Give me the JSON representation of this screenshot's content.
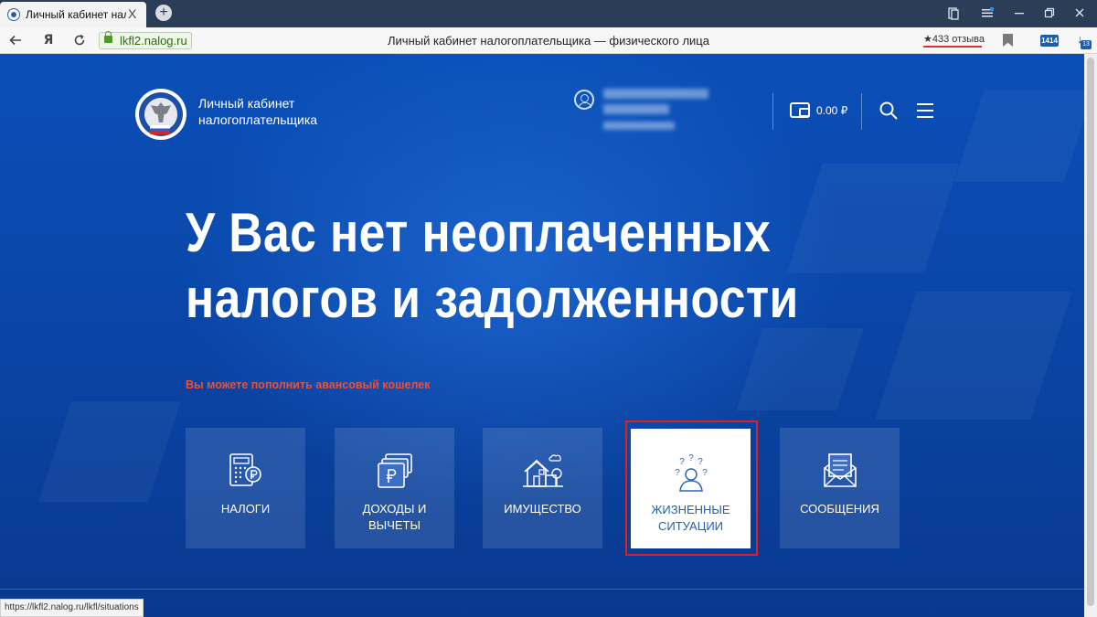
{
  "browser": {
    "tab_title": "Личный кабинет налогоплательщика",
    "tab_close": "X",
    "new_tab": "+",
    "url": "lkfl2.nalog.ru",
    "page_title": "Личный кабинет налогоплательщика — физического лица",
    "reviews": "★433 отзыва",
    "ext_badge": "1414",
    "dl_count": "13",
    "status_url": "https://lkfl2.nalog.ru/lkfl/situations"
  },
  "header": {
    "logo_line1": "Личный кабинет",
    "logo_line2": "налогоплательщика",
    "balance": "0.00 ₽"
  },
  "main": {
    "headline_line1": "У Вас нет неоплаченных",
    "headline_line2": "налогов и задолженности",
    "wallet_hint": "Вы можете пополнить авансовый кошелек"
  },
  "tiles": [
    {
      "label_line1": "НАЛОГИ",
      "label_line2": ""
    },
    {
      "label_line1": "ДОХОДЫ И",
      "label_line2": "ВЫЧЕТЫ"
    },
    {
      "label_line1": "ИМУЩЕСТВО",
      "label_line2": ""
    },
    {
      "label_line1": "ЖИЗНЕННЫЕ",
      "label_line2": "СИТУАЦИИ"
    },
    {
      "label_line1": "СООБЩЕНИЯ",
      "label_line2": ""
    }
  ],
  "colors": {
    "background": "#0a4fb8",
    "accent_text": "#1f5fb5",
    "warning_text": "#e8523a",
    "highlight": "#e02020"
  }
}
